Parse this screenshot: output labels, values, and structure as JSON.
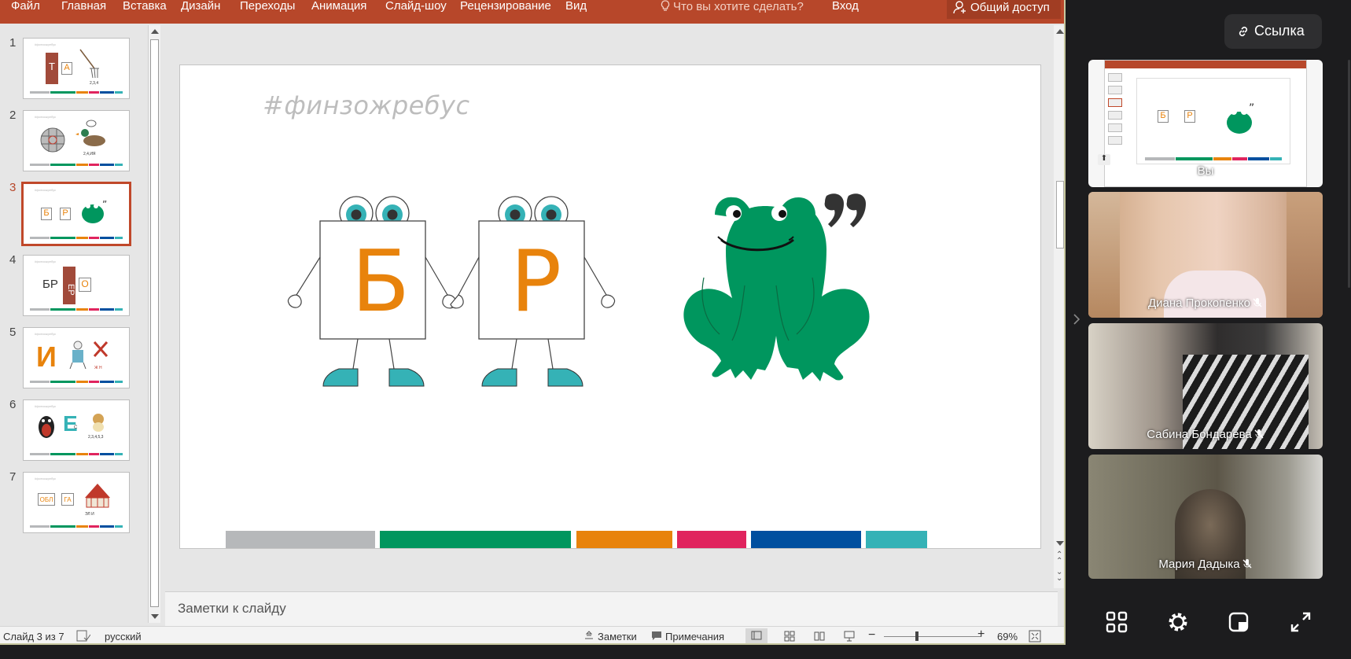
{
  "ribbon": {
    "tabs": [
      "Файл",
      "Главная",
      "Вставка",
      "Дизайн",
      "Переходы",
      "Анимация",
      "Слайд-шоу",
      "Рецензирование",
      "Вид"
    ],
    "tell_me": "Что вы хотите сделать?",
    "sign_in": "Вход",
    "share": "Общий доступ"
  },
  "thumbnails": [
    {
      "num": "1",
      "title": "#финзожребус"
    },
    {
      "num": "2",
      "title": "#финзожребус"
    },
    {
      "num": "3",
      "title": "#финзожребус"
    },
    {
      "num": "4",
      "title": "#финзожребус"
    },
    {
      "num": "5",
      "title": "#финзожребус"
    },
    {
      "num": "6",
      "title": "#финзожребус"
    },
    {
      "num": "7",
      "title": "#финзожребус"
    }
  ],
  "thumb_texts": {
    "t1_a": "Т",
    "t1_b": "А",
    "t1_note": "2,3,4",
    "t2_note": "2,4,ИЯ",
    "t3_a": "Б",
    "t3_b": "Р",
    "t4_a": "БР",
    "t4_b": "ЕР",
    "t4_c": "О",
    "t5_a": "И",
    "t5_note": "Ж Н",
    "t6_a": "Е",
    "t6_b": "С",
    "t6_note": "2,3,4,5,3",
    "t7_a": "ОБЛ",
    "t7_b": "ГА",
    "t7_note": "ЭЛ И"
  },
  "slide": {
    "title": "#финзожребус",
    "letter_1": "Б",
    "letter_2": "Р",
    "colors": [
      "#b6b8ba",
      "#00965e",
      "#e8830c",
      "#e0245e",
      "#004f9f",
      "#35b2b6"
    ]
  },
  "notes_placeholder": "Заметки к слайду",
  "status": {
    "slide_info": "Слайд 3 из 7",
    "language": "русский",
    "notes": "Заметки",
    "comments": "Примечания",
    "zoom": "69%"
  },
  "meeting": {
    "link_button": "Ссылка",
    "participants": [
      {
        "name": "Вы"
      },
      {
        "name": "Диана Прокопенко"
      },
      {
        "name": "Сабина Бондарева"
      },
      {
        "name": "Мария Дадыка"
      }
    ],
    "icons": [
      "grid-icon",
      "gear-icon",
      "layout-icon",
      "fullscreen-icon"
    ]
  }
}
